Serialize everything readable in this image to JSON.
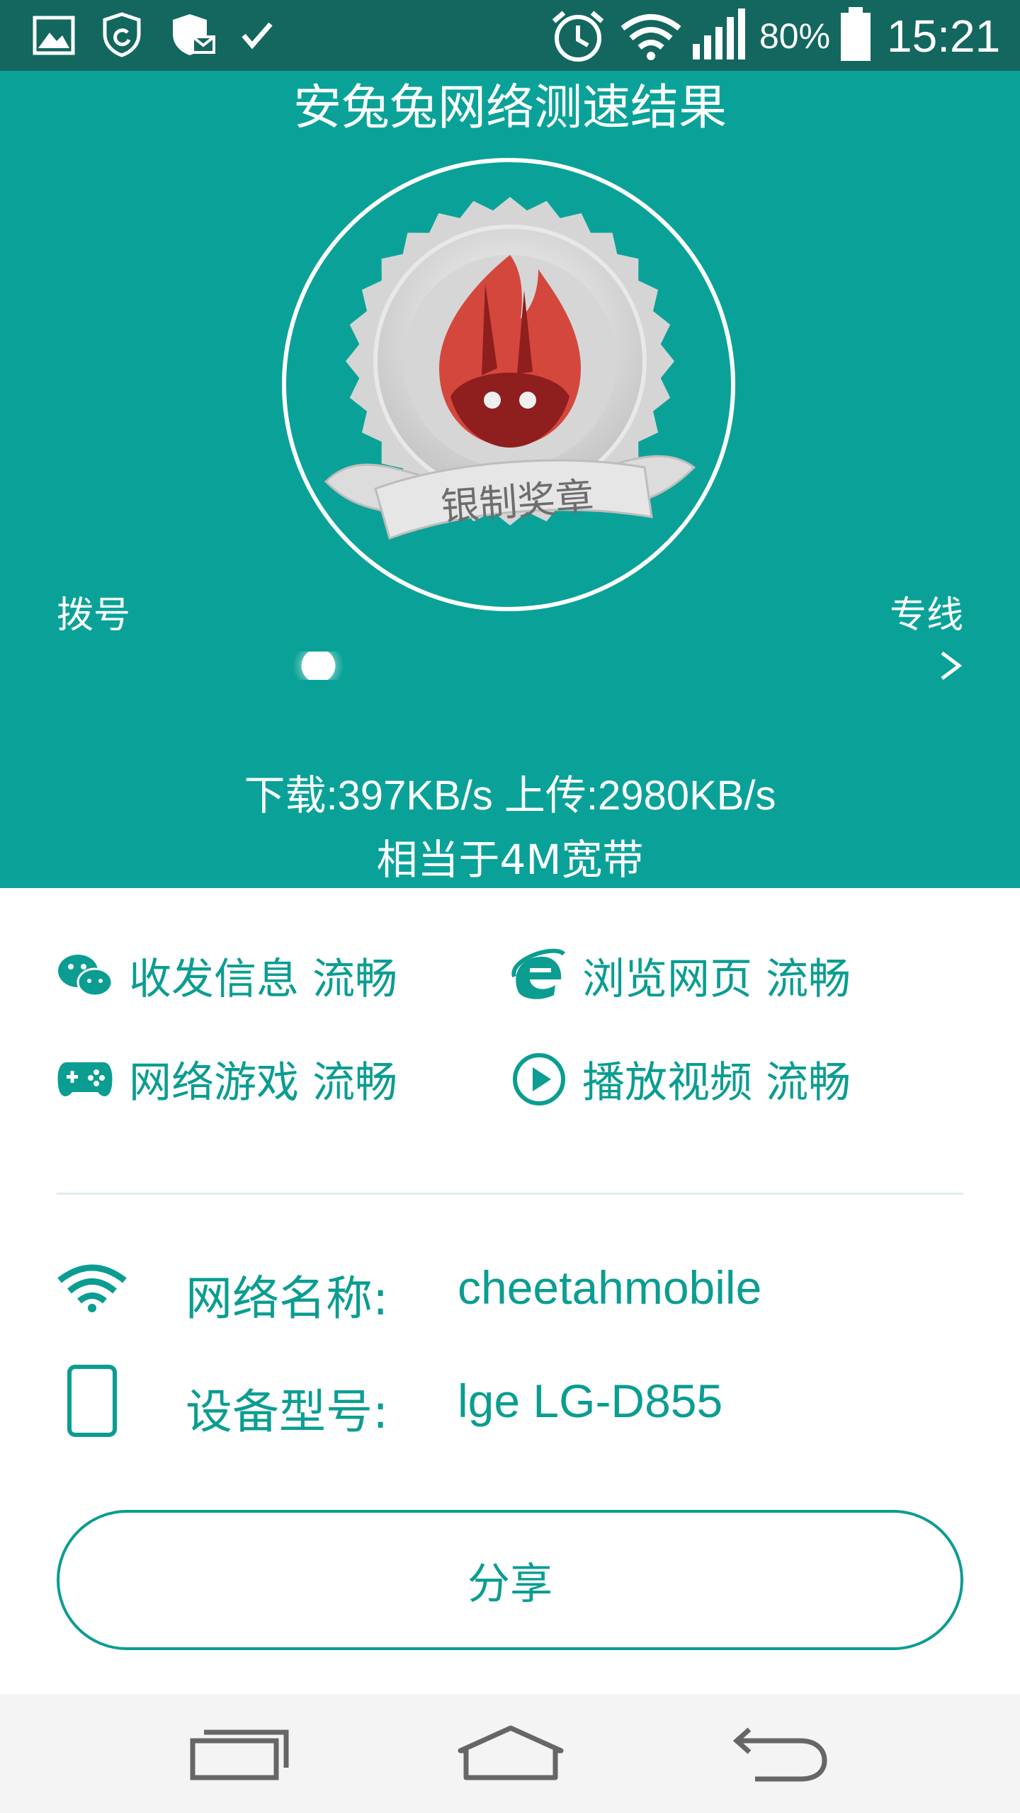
{
  "status_bar": {
    "battery": "80%",
    "time": "15:21",
    "icons": [
      "image-icon",
      "shield-refresh-icon",
      "shield-mail-icon",
      "check-icon",
      "alarm-icon",
      "wifi-icon",
      "signal-icon",
      "battery-icon"
    ]
  },
  "header": {
    "title": "安兔兔网络测速结果",
    "badge_text": "银制奖章",
    "scale_left": "拨号",
    "scale_right": "专线",
    "speed_position": 0.29,
    "speed": "下载:397KB/s 上传:2980KB/s",
    "equivalent": "相当于4M宽带"
  },
  "features": [
    {
      "icon": "wechat-icon",
      "label": "收发信息 流畅"
    },
    {
      "icon": "ie-browser-icon",
      "label": "浏览网页 流畅"
    },
    {
      "icon": "gamepad-icon",
      "label": "网络游戏 流畅"
    },
    {
      "icon": "play-circle-icon",
      "label": "播放视频 流畅"
    }
  ],
  "info": {
    "network_label": "网络名称:",
    "network_value": "cheetahmobile",
    "device_label": "设备型号:",
    "device_value": "lge LG-D855"
  },
  "share_label": "分享",
  "colors": {
    "status_bar": "#13675f",
    "hero": "#0aa298",
    "accent": "#0b9d91",
    "medal_red": "#d4473c"
  }
}
